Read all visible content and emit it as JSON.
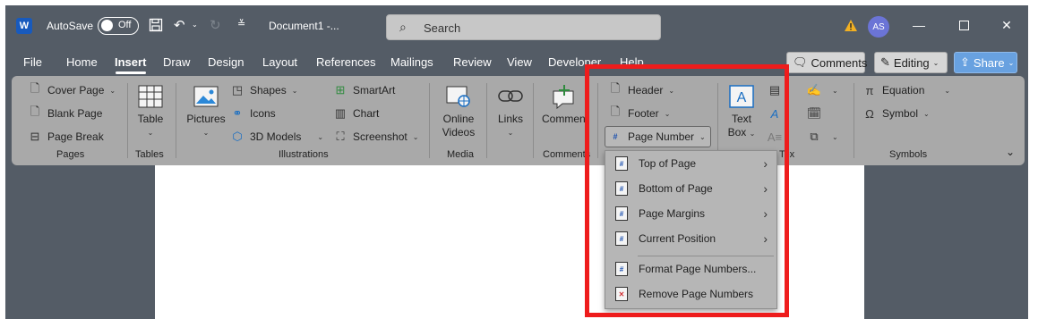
{
  "titlebar": {
    "app_icon_letter": "W",
    "autosave_label": "AutoSave",
    "autosave_state": "Off",
    "doc_name": "Document1 -...",
    "search_placeholder": "Search",
    "avatar_initials": "AS"
  },
  "menu": {
    "tabs": [
      "File",
      "Home",
      "Insert",
      "Draw",
      "Design",
      "Layout",
      "References",
      "Mailings",
      "Review",
      "View",
      "Developer",
      "Help"
    ],
    "active_tab": "Insert",
    "comments_btn": "Comments",
    "editing_btn": "Editing",
    "share_btn": "Share"
  },
  "ribbon": {
    "pages": {
      "items": [
        "Cover Page",
        "Blank Page",
        "Page Break"
      ],
      "label": "Pages"
    },
    "tables": {
      "table": "Table",
      "label": "Tables"
    },
    "illustrations": {
      "pictures": "Pictures",
      "shapes": "Shapes",
      "icons": "Icons",
      "models": "3D Models",
      "smartart": "SmartArt",
      "chart": "Chart",
      "screenshot": "Screenshot",
      "label": "Illustrations"
    },
    "media": {
      "online_videos_1": "Online",
      "online_videos_2": "Videos",
      "label": "Media"
    },
    "links": {
      "links": "Links"
    },
    "comments": {
      "comment": "Comment",
      "label": "Comments"
    },
    "header_footer": {
      "header": "Header",
      "footer": "Footer",
      "page_number": "Page Number"
    },
    "text": {
      "textbox_1": "Text",
      "textbox_2": "Box",
      "label_partial": "Tex"
    },
    "symbols": {
      "equation": "Equation",
      "symbol": "Symbol",
      "label": "Symbols"
    }
  },
  "dropdown": {
    "items": [
      {
        "label": "Top of Page",
        "arrow": true
      },
      {
        "label": "Bottom of Page",
        "arrow": true
      },
      {
        "label": "Page Margins",
        "arrow": true
      },
      {
        "label": "Current Position",
        "arrow": true
      },
      {
        "label": "Format Page Numbers...",
        "arrow": false
      },
      {
        "label": "Remove Page Numbers",
        "arrow": false
      }
    ]
  },
  "colors": {
    "accent_blue": "#68a1e0",
    "highlight_red": "#ee1c1c",
    "titlebar_bg": "#545c66"
  }
}
